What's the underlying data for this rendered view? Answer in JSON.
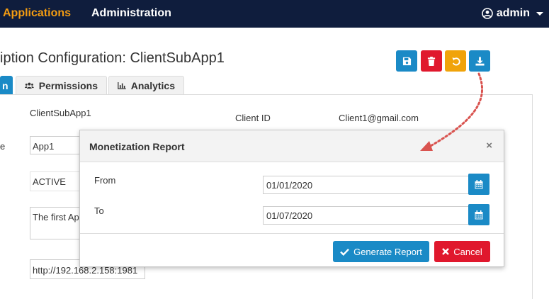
{
  "nav": {
    "applications": "Applications",
    "administration": "Administration",
    "user": "admin"
  },
  "page": {
    "title": "iption Configuration: ClientSubApp1"
  },
  "toolbar": {
    "save_icon": "save-icon",
    "delete_icon": "trash-icon",
    "undo_icon": "undo-icon",
    "download_icon": "download-icon"
  },
  "tabs": {
    "active_label": "n",
    "permissions": "Permissions",
    "analytics": "Analytics"
  },
  "background_form": {
    "name_value": "ClientSubApp1",
    "client_id_label": "Client ID",
    "client_id_value": "Client1@gmail.com",
    "label_fragment": "e",
    "app_value": "App1",
    "status_value": "ACTIVE",
    "description_value": "The first Ap",
    "url_value": "http://192.168.2.158:1981"
  },
  "modal": {
    "title": "Monetization Report",
    "close": "×",
    "from_label": "From",
    "from_value": "01/01/2020",
    "to_label": "To",
    "to_value": "01/07/2020",
    "generate_label": "Generate Report",
    "cancel_label": "Cancel"
  },
  "colors": {
    "navbar": "#0f1d3d",
    "accent": "#1a8ac6",
    "danger": "#e0182d",
    "warning": "#f0a30a",
    "apps_link": "#f39c12"
  }
}
